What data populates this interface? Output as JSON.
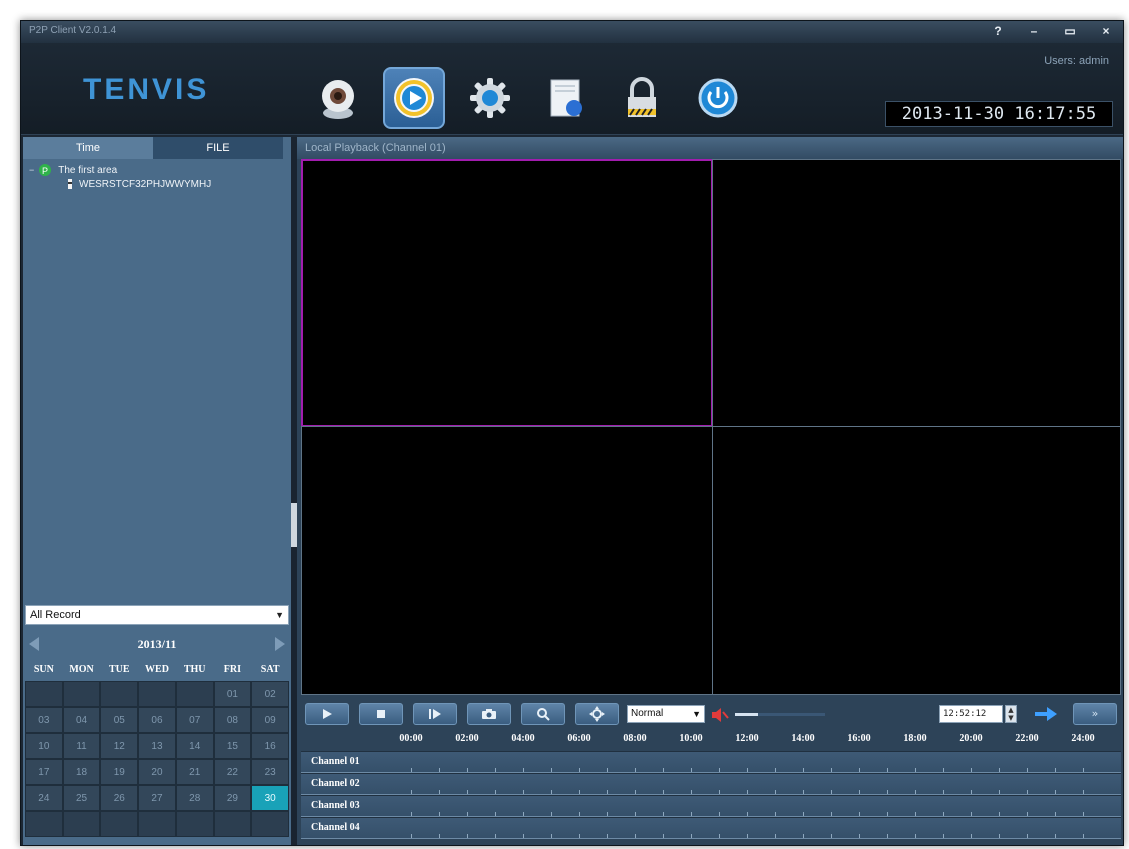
{
  "window": {
    "title": "P2P Client V2.0.1.4"
  },
  "window_controls": {
    "help": "?",
    "minimize": "–",
    "maximize": "▭",
    "close": "×"
  },
  "header": {
    "logo": "TENVIS",
    "user": "Users: admin",
    "datetime": "2013-11-30 16:17:55"
  },
  "nav": [
    {
      "name": "camera-icon"
    },
    {
      "name": "playback-icon",
      "active": true
    },
    {
      "name": "settings-gear-icon"
    },
    {
      "name": "log-document-icon"
    },
    {
      "name": "lock-icon"
    },
    {
      "name": "power-icon"
    }
  ],
  "left_panel": {
    "tabs": [
      {
        "label": "Time"
      },
      {
        "label": "FILE"
      }
    ],
    "tree": {
      "area": "The first area",
      "device": "WESRSTCF32PHJWWYMHJ"
    },
    "record_filter": "All Record",
    "calendar": {
      "month": "2013/11",
      "weekdays": [
        "SUN",
        "MON",
        "TUE",
        "WED",
        "THU",
        "FRI",
        "SAT"
      ],
      "weeks": [
        [
          "",
          "",
          "",
          "",
          "",
          "01",
          "02"
        ],
        [
          "03",
          "04",
          "05",
          "06",
          "07",
          "08",
          "09"
        ],
        [
          "10",
          "11",
          "12",
          "13",
          "14",
          "15",
          "16"
        ],
        [
          "17",
          "18",
          "19",
          "20",
          "21",
          "22",
          "23"
        ],
        [
          "24",
          "25",
          "26",
          "27",
          "28",
          "29",
          "30"
        ],
        [
          "",
          "",
          "",
          "",
          "",
          "",
          ""
        ]
      ],
      "selected": "30"
    }
  },
  "main": {
    "header": "Local Playback (Channel 01)",
    "speed": "Normal",
    "volume": 0.25,
    "time_value": "12:52:12",
    "expand_glyph": "»"
  },
  "timeline": {
    "hours": [
      "00:00",
      "02:00",
      "04:00",
      "06:00",
      "08:00",
      "10:00",
      "12:00",
      "14:00",
      "16:00",
      "18:00",
      "20:00",
      "22:00",
      "24:00"
    ],
    "channels": [
      "Channel 01",
      "Channel 02",
      "Channel 03",
      "Channel 04"
    ]
  },
  "colors": {
    "selected_pane": "#a21dae",
    "selected_day": "#19a2b8",
    "accent": "#3f94d6"
  }
}
